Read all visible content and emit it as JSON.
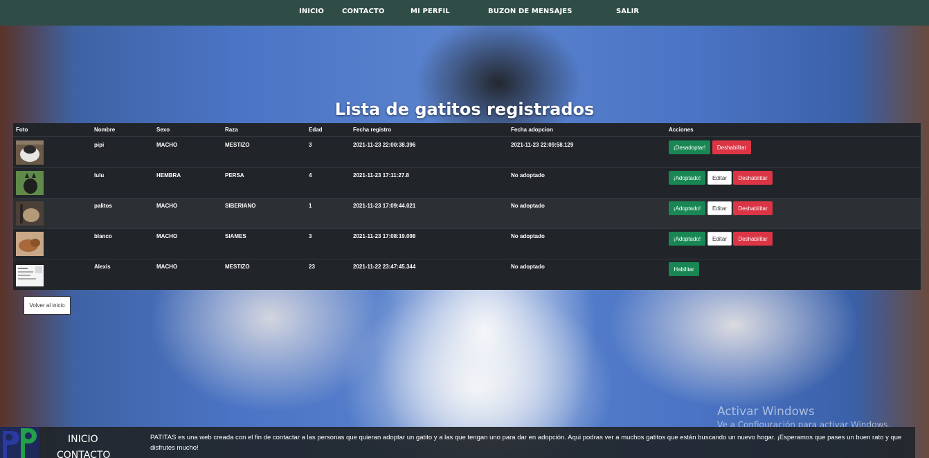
{
  "nav": {
    "items": [
      "INICIO",
      "CONTACTO",
      "MI PERFIL",
      "BUZON DE MENSAJES",
      "SALIR"
    ]
  },
  "title": "Lista de gatitos registrados",
  "table": {
    "headers": [
      "Foto",
      "Nombre",
      "Sexo",
      "Raza",
      "Edad",
      "Fecha registro",
      "Fecha adopcion",
      "Acciones"
    ],
    "rows": [
      {
        "nombre": "pipi",
        "sexo": "MACHO",
        "raza": "MESTIZO",
        "edad": "3",
        "registro": "2021-11-23 22:00:38.396",
        "adopcion": "2021-11-23 22:09:58.129",
        "actions": [
          "¡Desadoptar!",
          "Deshabilitar"
        ]
      },
      {
        "nombre": "lulu",
        "sexo": "HEMBRA",
        "raza": "PERSA",
        "edad": "4",
        "registro": "2021-11-23 17:11:27.8",
        "adopcion": "No adoptado",
        "actions": [
          "¡Adoptado!",
          "Editar",
          "Deshabilitar"
        ]
      },
      {
        "nombre": "palitos",
        "sexo": "MACHO",
        "raza": "SIBERIANO",
        "edad": "1",
        "registro": "2021-11-23 17:09:44.021",
        "adopcion": "No adoptado",
        "actions": [
          "¡Adoptado!",
          "Editar",
          "Deshabilitar"
        ]
      },
      {
        "nombre": "blanco",
        "sexo": "MACHO",
        "raza": "SIAMES",
        "edad": "3",
        "registro": "2021-11-23 17:08:19.098",
        "adopcion": "No adoptado",
        "actions": [
          "¡Adoptado!",
          "Editar",
          "Deshabilitar"
        ]
      },
      {
        "nombre": "Alexis",
        "sexo": "MACHO",
        "raza": "MESTIZO",
        "edad": "23",
        "registro": "2021-11-22 23:47:45.344",
        "adopcion": "No adoptado",
        "actions": [
          "Habilitar"
        ]
      }
    ]
  },
  "back_button": "Volver al inicio",
  "watermark": {
    "title": "Activar Windows",
    "subtitle": "Ve a Configuración para activar Windows."
  },
  "footer": {
    "links": [
      "INICIO",
      "CONTACTO"
    ],
    "text": "PATITAS es una web creada con el fin de contactar a las personas que quieran adoptar un gatito y a las que tengan uno para dar en adopción. Aqui podras ver a muchos gatitos que están buscando un nuevo hogar. ¡Esperamos que pases un buen rato y que disfrutes mucho!"
  },
  "colors": {
    "navbar": "#2f4d46",
    "table": "#212529",
    "success": "#198754",
    "danger": "#dc3545"
  }
}
